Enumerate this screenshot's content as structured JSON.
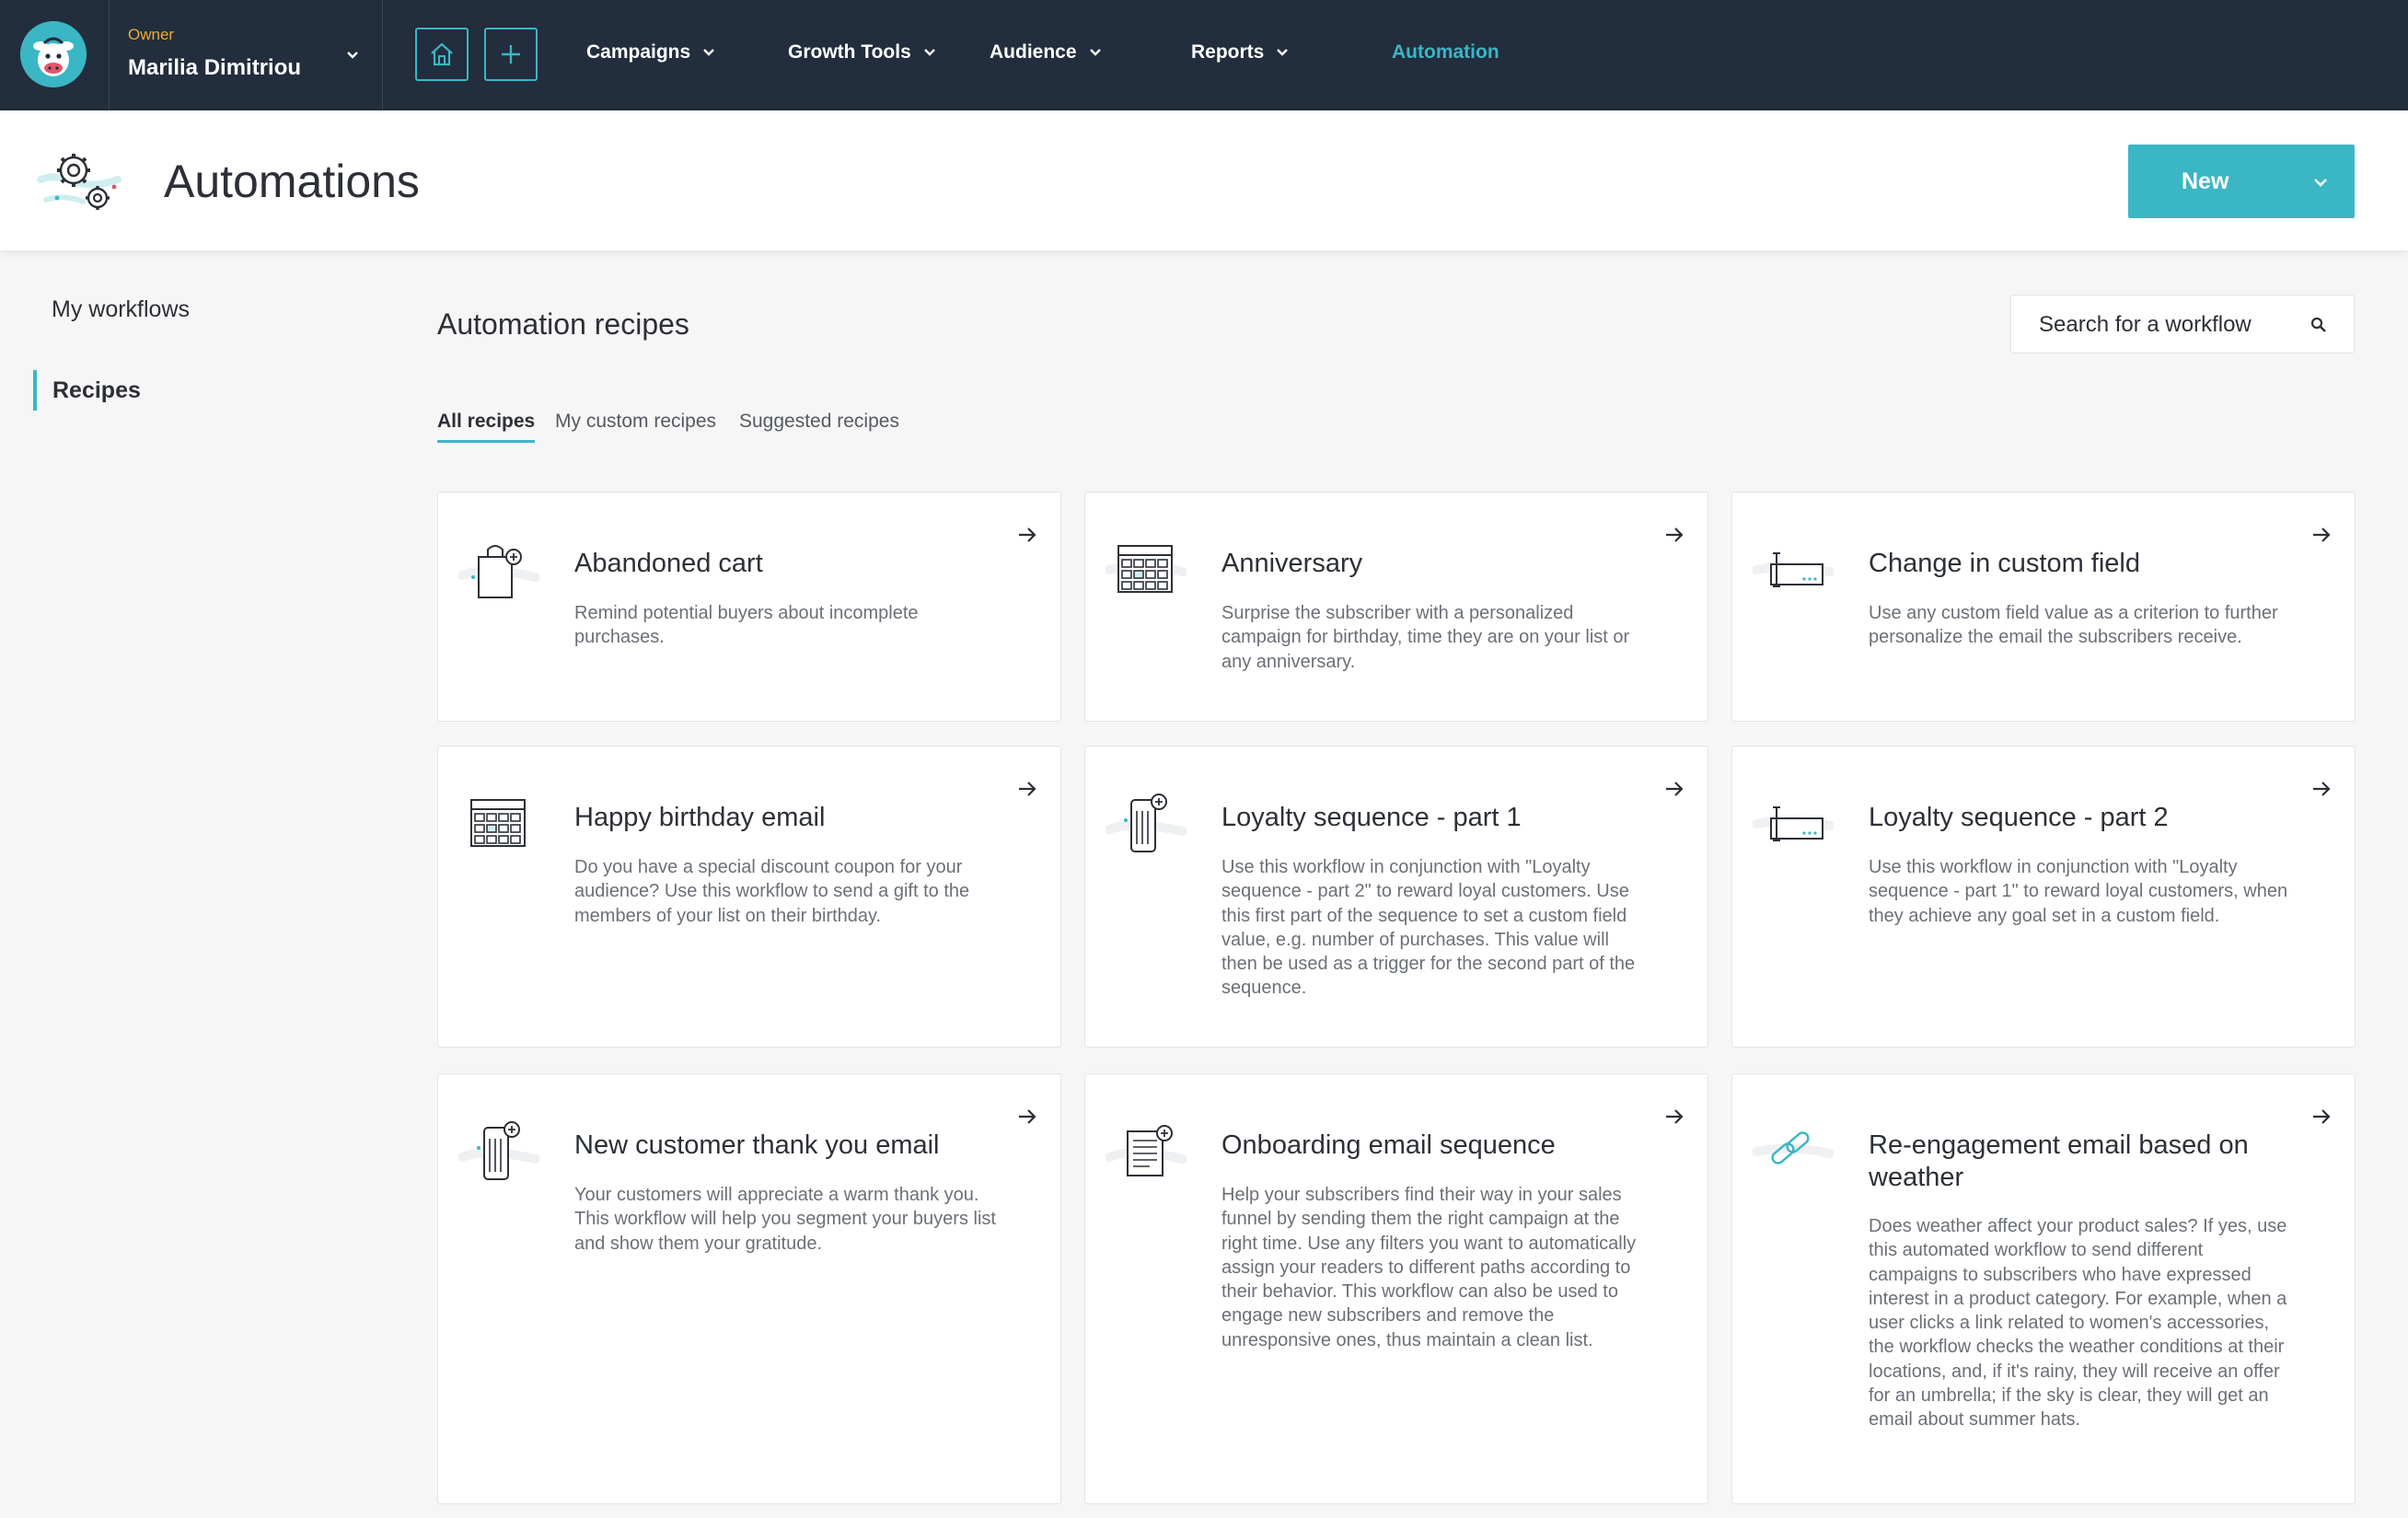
{
  "nav": {
    "owner_label": "Owner",
    "owner_name": "Marilia Dimitriou",
    "items": [
      {
        "label": "Campaigns"
      },
      {
        "label": "Growth Tools"
      },
      {
        "label": "Audience"
      },
      {
        "label": "Reports"
      },
      {
        "label": "Automation"
      }
    ],
    "accent_color": "#3bb6c4",
    "bar_color": "#222d3d"
  },
  "header": {
    "title": "Automations",
    "new_button_label": "New"
  },
  "sidebar": {
    "items": [
      {
        "label": "My workflows"
      },
      {
        "label": "Recipes"
      }
    ]
  },
  "main": {
    "section_title": "Automation recipes",
    "search_placeholder": "Search for a workflow",
    "tabs": [
      {
        "label": "All recipes"
      },
      {
        "label": "My custom recipes"
      },
      {
        "label": "Suggested recipes"
      }
    ],
    "cards": [
      {
        "title": "Abandoned cart",
        "description": "Remind potential buyers about incomplete purchases.",
        "icon": "shopping-bag-icon"
      },
      {
        "title": "Anniversary",
        "description": "Surprise the subscriber with a personalized campaign for birthday, time they are on your list or any anniversary.",
        "icon": "calendar-icon"
      },
      {
        "title": "Change in custom field",
        "description": "Use any custom field value as a criterion to further personalize the email the subscribers receive.",
        "icon": "custom-field-icon"
      },
      {
        "title": "Happy birthday email",
        "description": "Do you have a special discount coupon for your audience? Use this workflow to send a gift to the members of your list on their birthday.",
        "icon": "calendar-icon"
      },
      {
        "title": "Loyalty sequence - part 1",
        "description": "Use this workflow in conjunction with \"Loyalty sequence - part 2\" to reward loyal customers. Use this first part of the sequence to set a custom field value, e.g. number of purchases. This value will then be used as a trigger for the second part of the sequence.",
        "icon": "receipt-icon"
      },
      {
        "title": "Loyalty sequence - part 2",
        "description": "Use this workflow in conjunction with \"Loyalty sequence - part 1\" to reward loyal customers, when they achieve any goal set in a custom field.",
        "icon": "custom-field-icon"
      },
      {
        "title": "New customer thank you email",
        "description": "Your customers will appreciate a warm thank you. This workflow will help you segment your buyers list and show them your gratitude.",
        "icon": "receipt-icon"
      },
      {
        "title": "Onboarding email sequence",
        "description": "Help your subscribers find their way in your sales funnel by sending them the right campaign at the right time. Use any filters you want to automatically assign your readers to different paths according to their behavior. This workflow can also be used to engage new subscribers and remove the unresponsive ones, thus maintain a clean list.",
        "icon": "document-list-icon"
      },
      {
        "title": "Re-engagement email based on weather",
        "description": "Does weather affect your product sales? If yes, use this automated workflow to send different campaigns to subscribers who have expressed interest in a product category. For example, when a user clicks a link related to women's accessories, the workflow checks the weather conditions at their locations, and, if it's rainy, they will receive an offer for an umbrella; if the sky is clear, they will get an email about summer hats.",
        "icon": "link-icon"
      }
    ]
  }
}
